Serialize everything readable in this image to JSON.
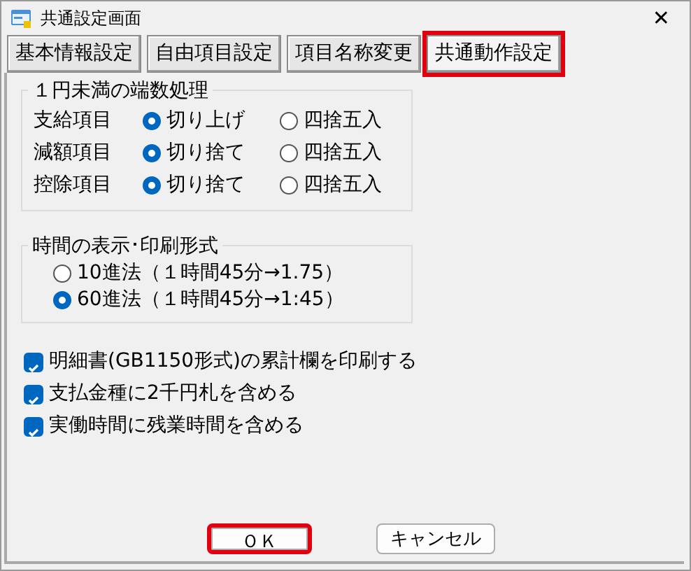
{
  "window": {
    "title": "共通設定画面",
    "close": "✕"
  },
  "tabs": [
    {
      "label": "基本情報設定",
      "selected": false,
      "highlighted": false
    },
    {
      "label": "自由項目設定",
      "selected": false,
      "highlighted": false
    },
    {
      "label": "項目名称変更",
      "selected": false,
      "highlighted": false
    },
    {
      "label": "共通動作設定",
      "selected": true,
      "highlighted": true
    }
  ],
  "rounding": {
    "title": "１円未満の端数処理",
    "rows": [
      {
        "label": "支給項目",
        "options": [
          {
            "label": "切り上げ",
            "selected": true
          },
          {
            "label": "四捨五入",
            "selected": false
          }
        ]
      },
      {
        "label": "減額項目",
        "options": [
          {
            "label": "切り捨て",
            "selected": true
          },
          {
            "label": "四捨五入",
            "selected": false
          }
        ]
      },
      {
        "label": "控除項目",
        "options": [
          {
            "label": "切り捨て",
            "selected": true
          },
          {
            "label": "四捨五入",
            "selected": false
          }
        ]
      }
    ]
  },
  "time_format": {
    "title": "時間の表示･印刷形式",
    "options": [
      {
        "label": "10進法（１時間45分→1.75）",
        "selected": false
      },
      {
        "label": "60進法（１時間45分→1:45）",
        "selected": true
      }
    ]
  },
  "checkboxes": [
    {
      "label": "明細書(GB1150形式)の累計欄を印刷する",
      "checked": true
    },
    {
      "label": "支払金種に2千円札を含める",
      "checked": true
    },
    {
      "label": "実働時間に残業時間を含める",
      "checked": true
    }
  ],
  "buttons": [
    {
      "label": "ＯＫ",
      "highlighted": true
    },
    {
      "label": "キャンセル",
      "highlighted": false
    }
  ]
}
